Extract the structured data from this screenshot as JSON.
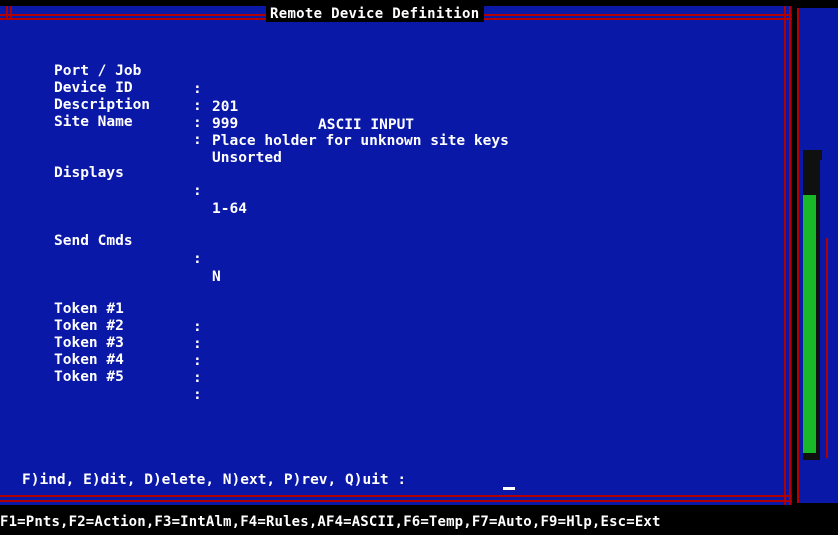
{
  "window": {
    "title": "Remote Device Definition"
  },
  "fields": [
    {
      "label": "Port / Job",
      "value": "201",
      "extra": "ASCII INPUT"
    },
    {
      "label": "Device ID",
      "value": "999"
    },
    {
      "label": "Description",
      "value": "Place holder for unknown site keys"
    },
    {
      "label": "Site Name",
      "value": "Unsorted"
    }
  ],
  "displays": {
    "label": "Displays",
    "value": "1-64"
  },
  "send_cmds": {
    "label": "Send Cmds",
    "value": "N"
  },
  "tokens": [
    {
      "label": "Token #1",
      "value": ""
    },
    {
      "label": "Token #2",
      "value": ""
    },
    {
      "label": "Token #3",
      "value": ""
    },
    {
      "label": "Token #4",
      "value": ""
    },
    {
      "label": "Token #5",
      "value": ""
    }
  ],
  "separator": ":",
  "prompt": "F)ind, E)dit, D)elete, N)ext, P)rev, Q)uit :",
  "function_keys": "F1=Pnts,F2=Action,F3=IntAlm,F4=Rules,AF4=ASCII,F6=Temp,F7=Auto,F9=Hlp,Esc=Ext",
  "colors": {
    "background": "#0a18a8",
    "frame": "#b00000",
    "text": "#ffffff",
    "scroll_thumb": "#18b828"
  }
}
